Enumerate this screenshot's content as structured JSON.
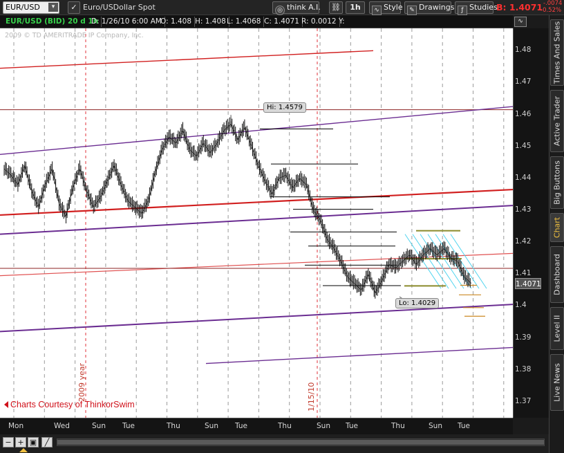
{
  "toolbar": {
    "symbol": "EUR/USD",
    "description": "Euro/USDollar Spot",
    "think_ai": "think A.I.",
    "timeframe": "1h",
    "style": "Style",
    "drawings": "Drawings",
    "studies": "Studies",
    "bid": "B: 1.4071",
    "change": "-.0074",
    "change_pct": "-0.52%"
  },
  "header2": {
    "series": "EUR/USD (BID) 20 d 1h",
    "date": "D: 1/26/10 6:00 AM",
    "open": "O: 1.408",
    "high": "H: 1.408",
    "low": "L: 1.4068",
    "close": "C: 1.4071",
    "range": "R: 0.0012",
    "y": "Y:"
  },
  "chart": {
    "copyright": "2009 © TD AMERITRADE IP Company, Inc.",
    "year_label": "2009 year",
    "date_label": "1/15/10",
    "courtesy": "Charts Courtesy of ThinkorSwim",
    "hi_label": "Hi: 1.4579",
    "lo_label": "Lo: 1.4029",
    "current_price": "1.4071"
  },
  "chart_data": {
    "type": "line",
    "title": "EUR/USD (BID) 20 d 1h",
    "ylim": [
      1.365,
      1.487
    ],
    "price_ticks": [
      "1.48",
      "1.47",
      "1.46",
      "1.45",
      "1.44",
      "1.43",
      "1.42",
      "1.41",
      "1.4",
      "1.39",
      "1.38",
      "1.37"
    ],
    "time_ticks": [
      "Mon",
      "Wed",
      "Sun",
      "Tue",
      "Thu",
      "Sun",
      "Tue",
      "Thu",
      "Sun",
      "Tue",
      "Thu",
      "Sun",
      "Tue"
    ],
    "high": 1.4579,
    "low": 1.4029,
    "last": 1.4071,
    "grid": "vertical dashed",
    "series": [
      {
        "values": [
          1.443,
          1.441,
          1.438,
          1.444,
          1.436,
          1.431,
          1.438,
          1.443,
          1.432,
          1.428,
          1.437,
          1.443,
          1.436,
          1.431,
          1.434,
          1.439,
          1.444,
          1.438,
          1.433,
          1.431,
          1.429,
          1.433,
          1.442,
          1.449,
          1.453,
          1.451,
          1.455,
          1.449,
          1.447,
          1.451,
          1.448,
          1.451,
          1.455,
          1.457,
          1.452,
          1.456,
          1.45,
          1.444,
          1.439,
          1.435,
          1.44,
          1.441,
          1.437,
          1.44,
          1.438,
          1.43,
          1.427,
          1.421,
          1.418,
          1.414,
          1.409,
          1.407,
          1.405,
          1.41,
          1.404,
          1.408,
          1.413,
          1.412,
          1.414,
          1.416,
          1.413,
          1.416,
          1.418,
          1.416,
          1.418,
          1.415,
          1.414,
          1.409,
          1.4071
        ]
      }
    ]
  },
  "bottom": {
    "zoom_out": "−",
    "zoom_in": "+",
    "crosshair": "▣",
    "draw": "╱"
  },
  "sidetabs": [
    "Times And Sales",
    "Active Trader",
    "Big Buttons",
    "Chart",
    "Dashboard",
    "Level II",
    "Live News"
  ],
  "colors": {
    "accent_red": "#e0303a",
    "channel_red": "#d11f1f",
    "channel_purple": "#6a2c91",
    "fib_cyan": "#4fd4ef",
    "olive": "#8a8a2a",
    "orange": "#cc8822"
  }
}
